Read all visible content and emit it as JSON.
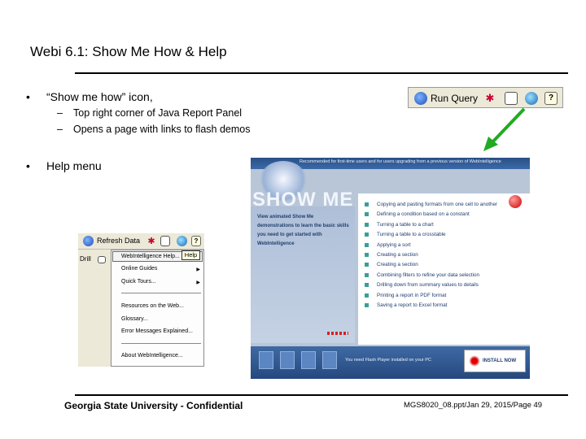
{
  "slide": {
    "title": "Webi 6.1: Show Me How & Help",
    "bullets": [
      {
        "text": "“Show me how” icon,",
        "subs": [
          "Top right corner of Java Report Panel",
          "Opens a page with links to flash demos"
        ]
      },
      {
        "text": "Help menu"
      }
    ],
    "bullet_symbol": "•",
    "dash_symbol": "–"
  },
  "toolbar": {
    "run_query_label": "Run Query",
    "icons": [
      "run-query-icon",
      "drill-icon",
      "document-icon",
      "show-me-how-icon",
      "help-icon"
    ]
  },
  "showme_page": {
    "banner_text": "Recommended for first-time users and for users upgrading from a previous version of WebIntelligence",
    "big_title": "SHOW ME",
    "description": "View animated Show Me demonstrations to learn the basic skills you need to get started with WebIntelligence",
    "demos": [
      "Copying and pasting formats from one cell to another",
      "Defining a condition based on a constant",
      "Turning a table to a chart",
      "Turning a table to a crosstable",
      "Applying a sort",
      "Creating a section",
      "Creating a section",
      "Combining filters to refine your data selection",
      "Drilling down from summary values to details",
      "Printing a report in PDF format",
      "Saving a report to Excel format"
    ],
    "flash_message": "You need Flash Player installed on your PC",
    "install_label": "INSTALL NOW"
  },
  "help_menu": {
    "toolbar_label": "Refresh Data",
    "drill_label": "Drill",
    "tooltip": "Help",
    "items": [
      "WebIntelligence Help...",
      "Online Guides",
      "Quick Tours...",
      "Resources on the Web...",
      "Glossary...",
      "Error Messages Explained...",
      "About WebIntelligence..."
    ]
  },
  "footer": {
    "left": "Georgia State University - Confidential",
    "right": "MGS8020_08.ppt/Jan 29, 2015/Page 49"
  },
  "colors": {
    "arrow": "#22aa22",
    "showme_banner": "#2a4f86",
    "demo_bullet": "#3b9e9a"
  }
}
